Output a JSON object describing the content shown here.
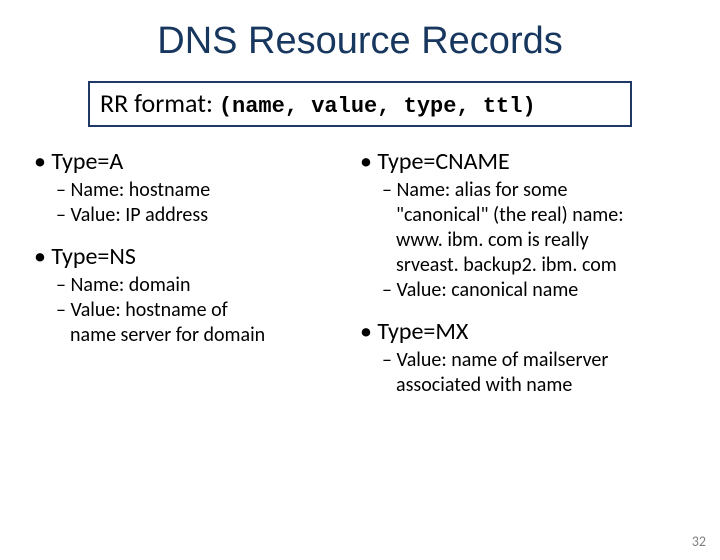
{
  "title": "DNS Resource Records",
  "rr": {
    "label": "RR format: ",
    "tuple": "(name, value, type, ttl)"
  },
  "left": {
    "a": {
      "heading": "• Type=A",
      "name": "– Name: hostname",
      "value": "– Value: IP address"
    },
    "ns": {
      "heading": "• Type=NS",
      "name": "– Name: domain",
      "value1": "– Value: hostname of",
      "value2": "name server for domain"
    }
  },
  "right": {
    "cname": {
      "heading": "• Type=CNAME",
      "l1": "– Name: alias for some",
      "l2": "\"canonical\" (the real) name:",
      "l3": "www. ibm. com is really",
      "l4": "srveast. backup2. ibm. com",
      "l5": "– Value: canonical name"
    },
    "mx": {
      "heading": "• Type=MX",
      "l1": "– Value: name of mailserver",
      "l2": "associated with name"
    }
  },
  "page": "32"
}
